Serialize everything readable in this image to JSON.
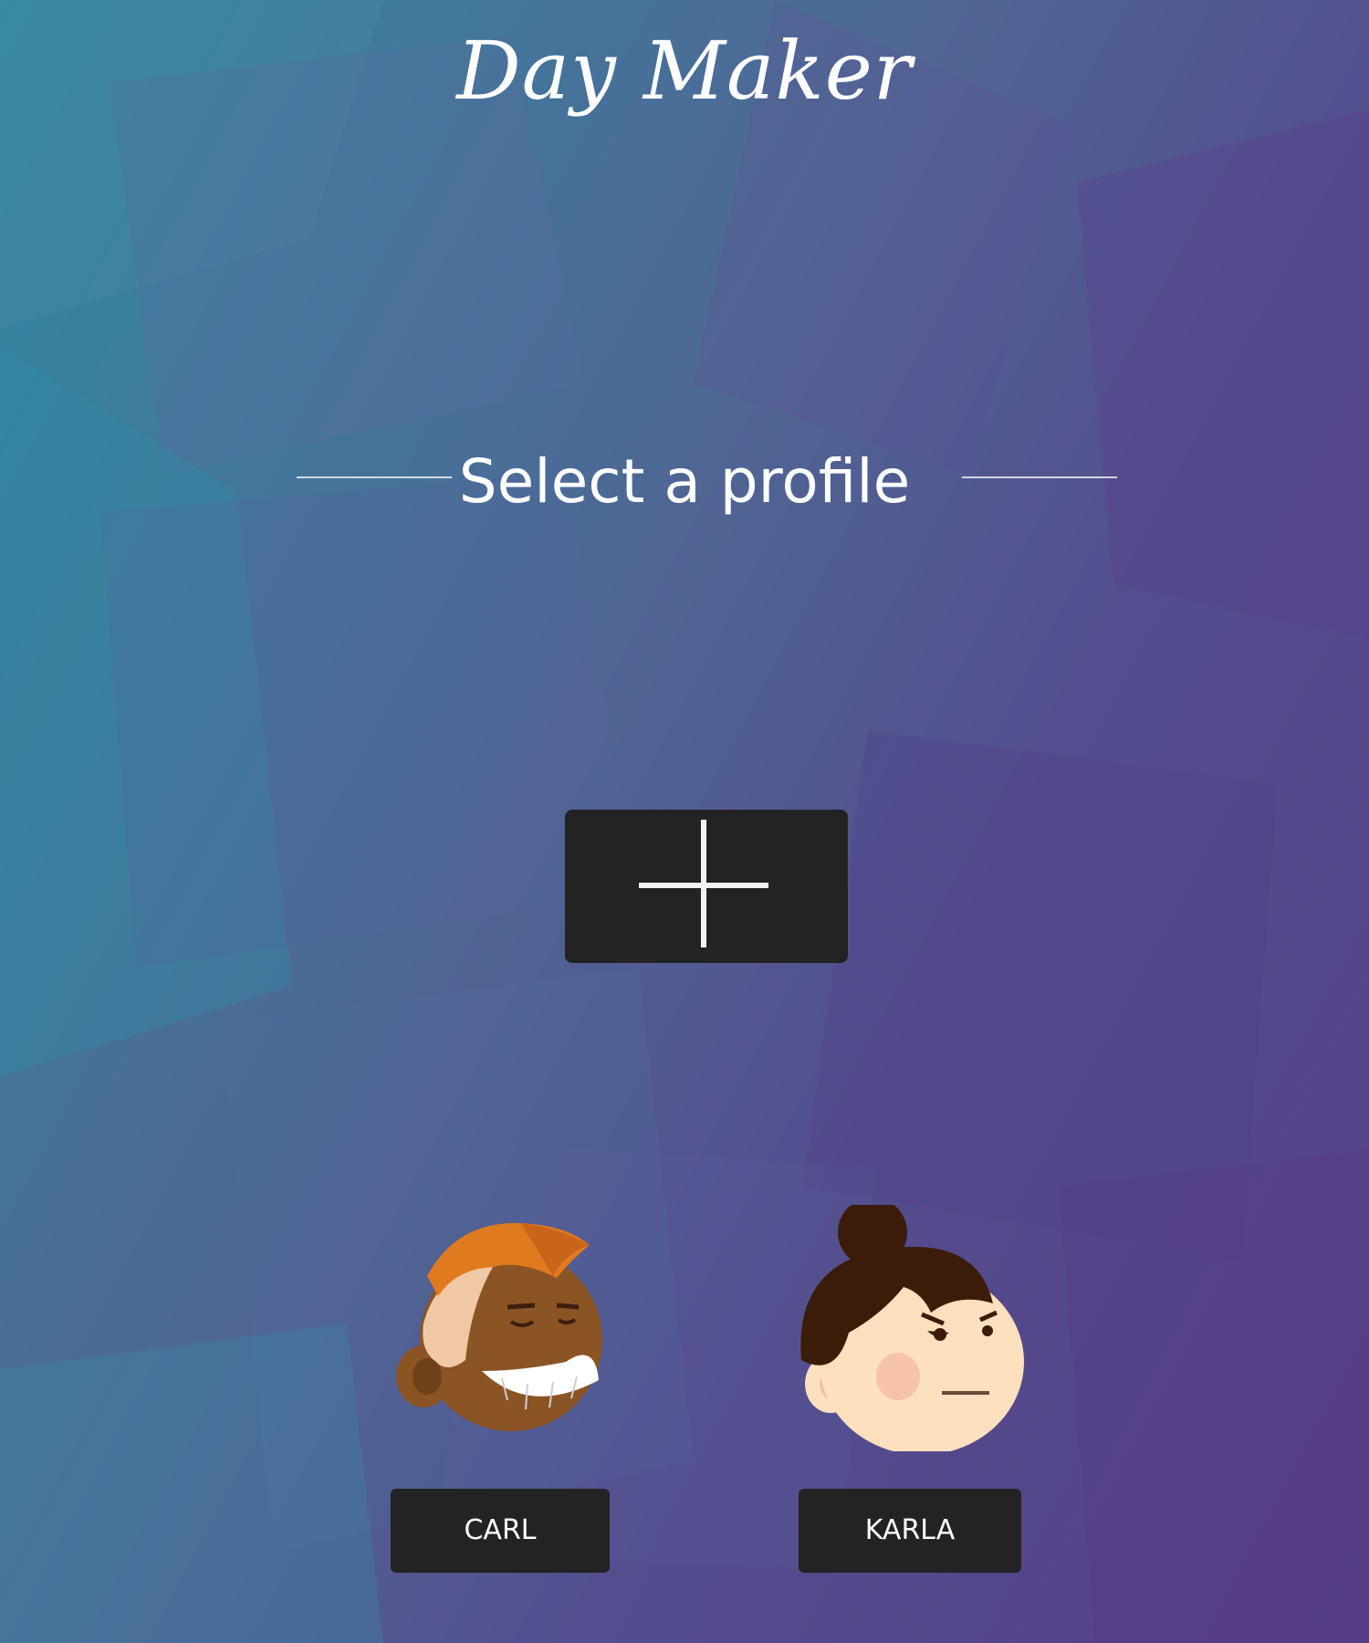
{
  "app": {
    "title": "Day Maker"
  },
  "main": {
    "heading": "Select a profile",
    "add_profile_icon": "plus-icon"
  },
  "profiles": [
    {
      "name": "CARL",
      "avatar_icon": "carl-avatar-icon"
    },
    {
      "name": "KARLA",
      "avatar_icon": "karla-avatar-icon"
    }
  ],
  "colors": {
    "button_bg": "#232323",
    "text": "#ffffff",
    "bg_teal": "#2f8aa3",
    "bg_purple": "#563d86"
  }
}
